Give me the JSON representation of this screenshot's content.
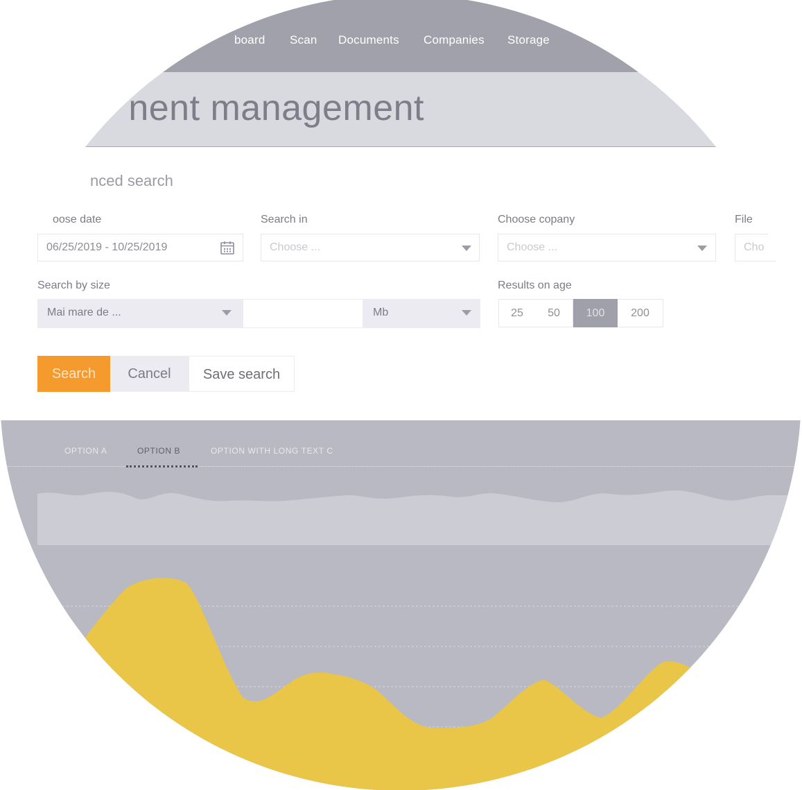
{
  "nav": {
    "items": [
      "board",
      "Scan",
      "Documents",
      "Companies",
      "Storage"
    ]
  },
  "header": {
    "title": "nent management"
  },
  "form": {
    "section_title": "nced search",
    "date_label": "oose date",
    "date_value": "06/25/2019 - 10/25/2019",
    "search_in_label": "Search in",
    "search_in_placeholder": "Choose ...",
    "company_label": "Choose copany",
    "company_placeholder": "Choose ...",
    "file_label": "File",
    "file_placeholder": "Cho",
    "size_label": "Search by size",
    "size_operator": "Mai mare de ...",
    "size_value": "",
    "size_unit": "Mb",
    "results_label": "Results on age",
    "results_options": [
      "25",
      "50",
      "100",
      "200"
    ],
    "results_selected": "100"
  },
  "buttons": {
    "search": "Search",
    "cancel": "Cancel",
    "save": "Save search"
  },
  "tabs": [
    "OPTION A",
    "OPTION B",
    "OPTION WITH LONG TEXT C"
  ],
  "active_tab": "OPTION B",
  "colors": {
    "accent_orange": "#f59a2c",
    "nav_bg": "#a0a1ab",
    "chart_bg": "#b8b9c3",
    "series_yellow": "#e9c548"
  },
  "icons": {
    "calendar": "calendar-icon",
    "dropdown": "chevron-down-icon"
  }
}
